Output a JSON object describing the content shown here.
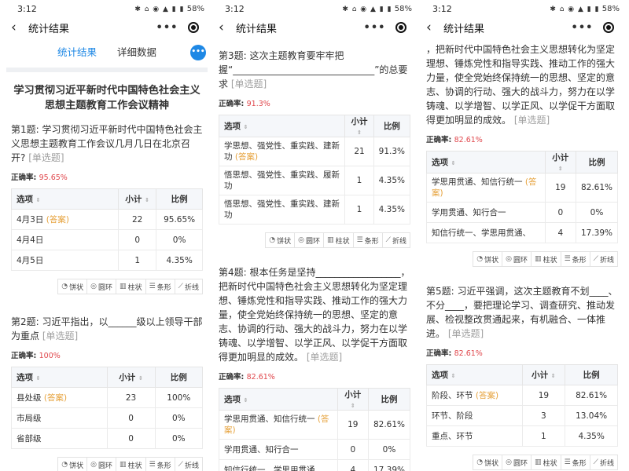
{
  "status": {
    "time": "3:12",
    "right_icons": "✱ ⌂ ◉ ▲ ▮ ▮",
    "battery": "58%"
  },
  "titlebar": {
    "back": "‹",
    "title": "统计结果",
    "more": "•••"
  },
  "tabs": {
    "stats": "统计结果",
    "detail": "详细数据",
    "fab": "•••"
  },
  "page_title": "学习贯彻习近平新时代中国特色社会主义思想主题教育工作会议精神",
  "labels": {
    "accuracy": "正确率: ",
    "option": "选项",
    "count": "小计",
    "ratio": "比例",
    "answer": "(答案)",
    "single": "[单选题]",
    "sort": "⇕"
  },
  "chart_buttons": [
    "饼状",
    "圆环",
    "柱状",
    "条形",
    "折线"
  ],
  "chart_icons": [
    "◔",
    "◎",
    "▥",
    "☰",
    "⟋"
  ],
  "q1": {
    "text": "第1题:  学习贯彻习近平新时代中国特色社会主义思想主题教育工作会议几月几日在北京召开?",
    "accuracy": "95.65%",
    "rows": [
      {
        "option": "4月3日",
        "answer": true,
        "count": "22",
        "ratio": "95.65%"
      },
      {
        "option": "4月4日",
        "answer": false,
        "count": "0",
        "ratio": "0%"
      },
      {
        "option": "4月5日",
        "answer": false,
        "count": "1",
        "ratio": "4.35%"
      }
    ]
  },
  "q2": {
    "text": "第2题:  习近平指出，以______级以上领导干部为重点",
    "accuracy": "100%",
    "rows": [
      {
        "option": "县处级",
        "answer": true,
        "count": "23",
        "ratio": "100%"
      },
      {
        "option": "市局级",
        "answer": false,
        "count": "0",
        "ratio": "0%"
      },
      {
        "option": "省部级",
        "answer": false,
        "count": "0",
        "ratio": "0%"
      }
    ]
  },
  "q3": {
    "text": "第3题:  这次主题教育要牢牢把握“______________________________”的总要求",
    "accuracy": "91.3%",
    "rows": [
      {
        "option": "学思想、强党性、重实践、建新功",
        "answer": true,
        "count": "21",
        "ratio": "91.3%"
      },
      {
        "option": "悟思想、强党性、重实践、履新功",
        "answer": false,
        "count": "1",
        "ratio": "4.35%"
      },
      {
        "option": "悟思想、强党性、重实践、建新功",
        "answer": false,
        "count": "1",
        "ratio": "4.35%"
      }
    ]
  },
  "q4": {
    "text": "第4题:  根本任务是坚持__________________，把新时代中国特色社会主义思想转化为坚定理想、锤炼党性和指导实践、推动工作的强大力量，使全党始终保持统一的思想、坚定的意志、协调的行动、强大的战斗力，努力在以学铸魂、以学增智、以学正风、以学促干方面取得更加明显的成效。",
    "accuracy": "82.61%",
    "rows": [
      {
        "option": "学思用贯通、知信行统一",
        "answer": true,
        "count": "19",
        "ratio": "82.61%"
      },
      {
        "option": "学用贯通、知行合一",
        "answer": false,
        "count": "0",
        "ratio": "0%"
      },
      {
        "option": "知信行统一、学思用贯通、",
        "answer": false,
        "count": "4",
        "ratio": "17.39%"
      }
    ]
  },
  "q4_cont": "，把新时代中国特色社会主义思想转化为坚定理想、锤炼党性和指导实践、推动工作的强大力量，使全党始终保持统一的思想、坚定的意志、协调的行动、强大的战斗力，努力在以学铸魂、以学增智、以学正风、以学促干方面取得更加明显的成效。",
  "q5": {
    "text": "第5题:  习近平强调，这次主题教育不划____、不分____，要把理论学习、调查研究、推动发展、检视整改贯通起来，有机融合、一体推进。",
    "accuracy": "82.61%",
    "rows": [
      {
        "option": "阶段、环节",
        "answer": true,
        "count": "19",
        "ratio": "82.61%"
      },
      {
        "option": "环节、阶段",
        "answer": false,
        "count": "3",
        "ratio": "13.04%"
      },
      {
        "option": "重点、环节",
        "answer": false,
        "count": "1",
        "ratio": "4.35%"
      }
    ]
  }
}
